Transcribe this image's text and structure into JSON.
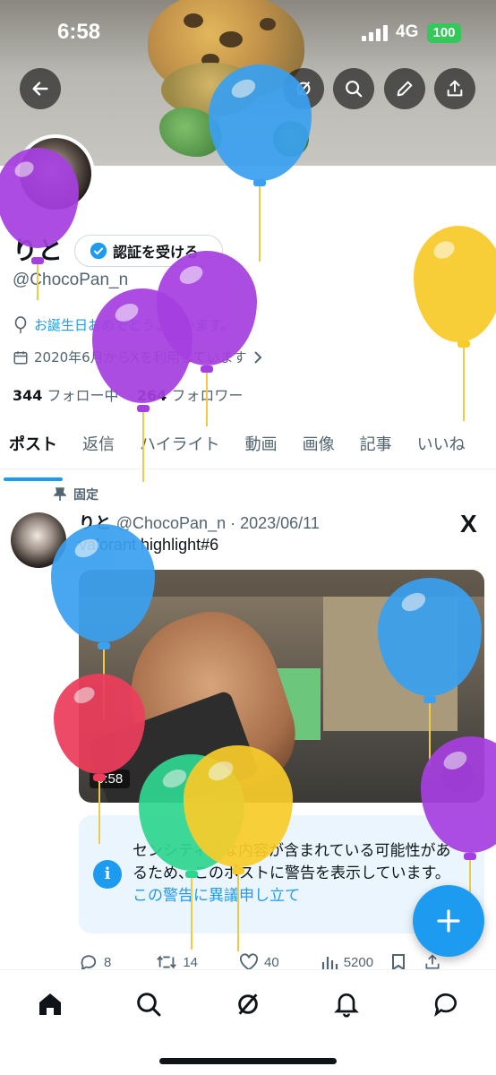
{
  "status_bar": {
    "time": "6:58",
    "network": "4G",
    "battery": "100"
  },
  "header": {
    "back_icon": "back-arrow-icon",
    "buttons": [
      "grok-icon",
      "search-icon",
      "edit-icon",
      "share-icon"
    ]
  },
  "profile": {
    "name": "りと",
    "verify_button": "認証を受ける",
    "handle": "@ChocoPan_n",
    "birthday_message": "お誕生日おめでとうございます。",
    "joined": "2020年6月からXを利用しています",
    "following_count": "344",
    "following_label": "フォロー中",
    "followers_count": "264",
    "followers_label": "フォロワー"
  },
  "tabs": [
    "ポスト",
    "返信",
    "ハイライト",
    "動画",
    "画像",
    "記事",
    "いいね"
  ],
  "post": {
    "pinned_label": "固定",
    "author": "りと",
    "meta": "@ChocoPan_n · 2023/06/11",
    "source_logo": "X",
    "text": "valorant highlight#6",
    "video_time": "0:58",
    "warning_text": "センシティブな内容が含まれている可能性があるため、このポストに警告を表示しています。",
    "warning_link": "この警告に異議申し立て",
    "replies": "8",
    "reposts": "14",
    "likes": "40",
    "views": "5200"
  },
  "fab_icon": "plus-icon",
  "bottom_nav": [
    "home-icon",
    "search-icon",
    "grok-icon",
    "notifications-icon",
    "messages-icon"
  ],
  "colors": {
    "accent": "#1d9bf0",
    "text": "#0f1419",
    "muted": "#536471",
    "balloons": [
      "#3aa0ef",
      "#a63fe0",
      "#f7cb2a",
      "#ec3d5c",
      "#2fd58f"
    ]
  }
}
